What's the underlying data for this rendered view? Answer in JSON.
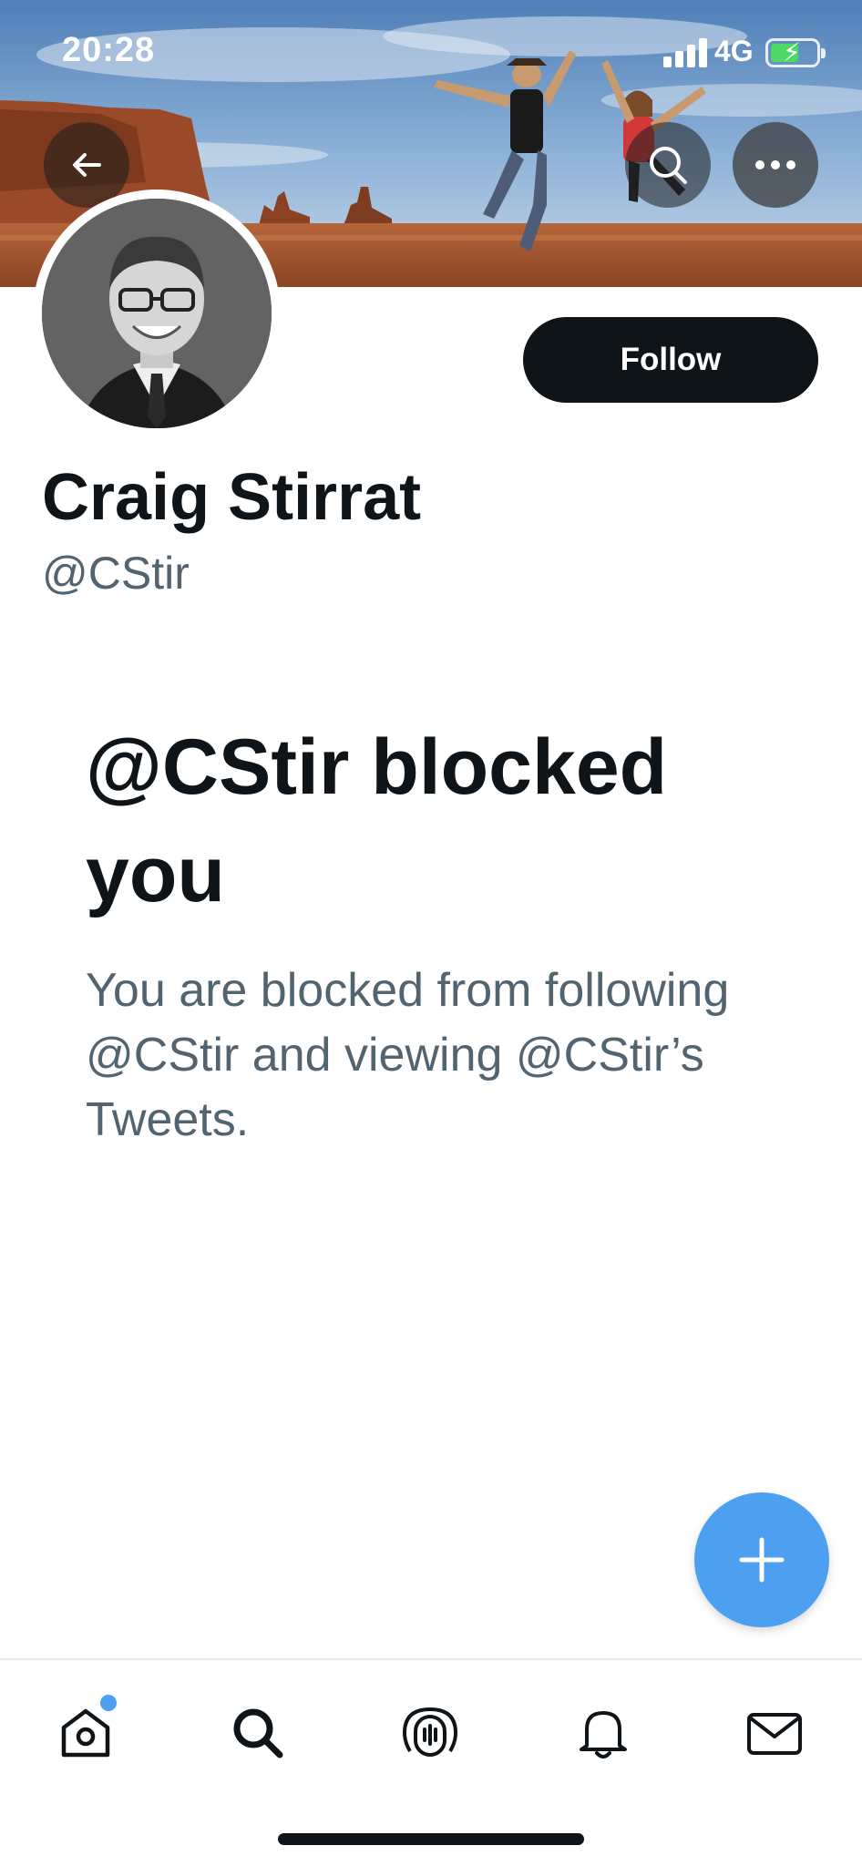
{
  "status_bar": {
    "time": "20:28",
    "network": "4G",
    "battery_level": 0.55,
    "battery_charging": true
  },
  "header": {
    "back_icon": "arrow-left-icon",
    "search_icon": "search-icon",
    "more_icon": "more-horizontal-icon"
  },
  "profile": {
    "display_name": "Craig Stirrat",
    "handle": "@CStir",
    "follow_label": "Follow"
  },
  "blocked_notice": {
    "title": "@CStir blocked you",
    "description": "You are blocked from following @CStir and viewing @CStir’s Tweets."
  },
  "fab": {
    "icon": "plus-icon"
  },
  "tabbar": {
    "items": [
      {
        "name": "home",
        "icon": "home-icon",
        "has_notification_dot": true
      },
      {
        "name": "search",
        "icon": "search-icon"
      },
      {
        "name": "spaces",
        "icon": "spaces-icon"
      },
      {
        "name": "notifications",
        "icon": "bell-icon"
      },
      {
        "name": "messages",
        "icon": "mail-icon"
      }
    ]
  },
  "colors": {
    "accent": "#4d9ff0",
    "text_primary": "#0f1419",
    "text_secondary": "#536471",
    "follow_button": "#0f1419"
  }
}
